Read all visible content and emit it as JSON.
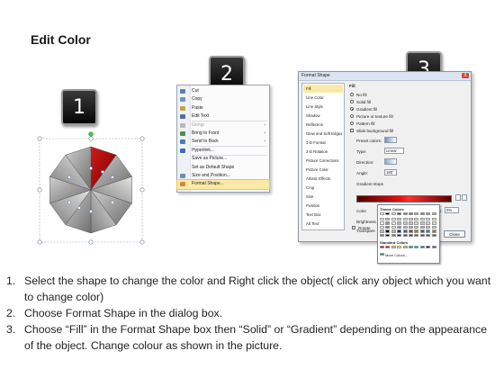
{
  "title": "Edit Color",
  "badges": [
    "1",
    "2",
    "3"
  ],
  "context_menu": {
    "items": [
      {
        "label": "Cut",
        "icon": "scissors-icon",
        "color": "#5b7fb5"
      },
      {
        "label": "Copy",
        "icon": "copy-icon",
        "color": "#7a93b8"
      },
      {
        "label": "Paste",
        "icon": "paste-icon",
        "color": "#c8a04a"
      },
      {
        "label": "Edit Text",
        "icon": "text-icon",
        "color": "#4b6fa8"
      },
      {
        "label": "Group",
        "icon": "group-icon",
        "color": "#b8b8b8",
        "disabled": true,
        "submenu": true
      },
      {
        "label": "Bring to Front",
        "icon": "bring-front-icon",
        "color": "#5a8a4a",
        "submenu": true
      },
      {
        "label": "Send to Back",
        "icon": "send-back-icon",
        "color": "#4a7ab0",
        "submenu": true
      },
      {
        "label": "Hyperlink...",
        "icon": "hyperlink-icon",
        "color": "#3d6cc0"
      },
      {
        "label": "Save as Picture...",
        "icon": "",
        "color": ""
      },
      {
        "label": "Set as Default Shape",
        "icon": "",
        "color": ""
      },
      {
        "label": "Size and Position...",
        "icon": "size-icon",
        "color": "#6b8fb8"
      },
      {
        "label": "Format Shape...",
        "icon": "format-shape-icon",
        "color": "#d08a3a",
        "highlighted": true
      }
    ]
  },
  "dialog": {
    "title": "Format Shape",
    "close": "X",
    "categories": [
      "Fill",
      "Line Color",
      "Line Style",
      "Shadow",
      "Reflection",
      "Glow and Soft Edges",
      "3-D Format",
      "3-D Rotation",
      "Picture Corrections",
      "Picture Color",
      "Artistic Effects",
      "Crop",
      "Size",
      "Position",
      "Text Box",
      "Alt Text"
    ],
    "selected_category": "Fill",
    "fill_heading": "Fill",
    "fill_options": [
      {
        "label": "No fill",
        "selected": false
      },
      {
        "label": "Solid fill",
        "selected": false
      },
      {
        "label": "Gradient fill",
        "selected": true
      },
      {
        "label": "Picture or texture fill",
        "selected": false
      },
      {
        "label": "Pattern fill",
        "selected": false
      }
    ],
    "slide_background_label": "Slide background fill",
    "preset_colors_label": "Preset colors:",
    "type_label": "Type:",
    "type_value": "Linear",
    "direction_label": "Direction:",
    "angle_label": "Angle:",
    "angle_value": "180°",
    "gradient_stops_label": "Gradient stops",
    "color_label": "Color",
    "position_label": "Position:",
    "position_value": "0%",
    "brightness_label": "Brightness",
    "transparency_label": "Transpare",
    "rotate_label": "Rotate",
    "theme_colors_label": "Theme Colors",
    "standard_colors_label": "Standard Colors",
    "more_colors_label": "More Colors...",
    "close_button": "Close",
    "theme_top_row": [
      "#ffffff",
      "#000000",
      "#eeece1",
      "#1f497d",
      "#4f81bd",
      "#c0504d",
      "#9bbb59",
      "#8064a2",
      "#4bacc6",
      "#f79646"
    ],
    "standard_colors": [
      "#c00000",
      "#ff0000",
      "#ffc000",
      "#ffff00",
      "#92d050",
      "#00b050",
      "#00b0f0",
      "#0070c0",
      "#002060",
      "#7030a0"
    ]
  },
  "instructions": [
    {
      "num": "1.",
      "text": "Select the shape to change the color and Right click the object( click any object which you want to change color)"
    },
    {
      "num": "2.",
      "text": "Choose Format Shape in the dialog box."
    },
    {
      "num": "3.",
      "text": "Choose “Fill” in the Format Shape box then “Solid” or “Gradient” depending on the appearance of the object. Change colour as shown in the picture."
    }
  ]
}
